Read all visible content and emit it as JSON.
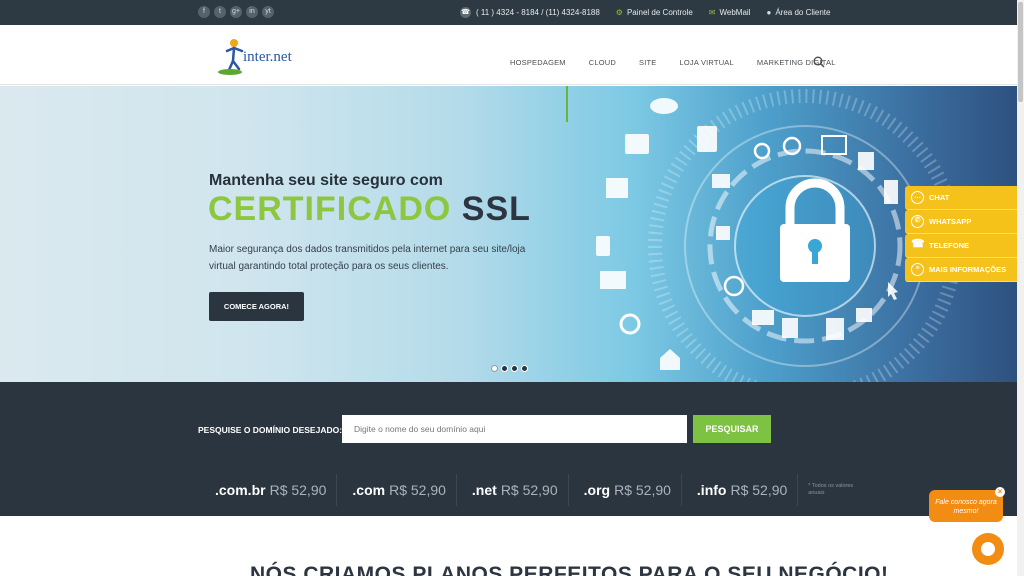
{
  "topbar": {
    "social_icons": [
      "f",
      "t",
      "g+",
      "in",
      "yt"
    ],
    "phone": "( 11 ) 4324 - 8184 / (11) 4324-8188",
    "links": [
      "Painel de Controle",
      "WebMail",
      "Área do Cliente"
    ]
  },
  "header": {
    "logo_text": "inter.net",
    "nav": [
      "HOSPEDAGEM",
      "CLOUD",
      "SITE",
      "LOJA VIRTUAL",
      "MARKETING DIGITAL"
    ]
  },
  "hero": {
    "subtitle": "Mantenha seu site seguro com",
    "title_green": "CERTIFICADO",
    "title_dark": "SSL",
    "description": "Maior segurança dos dados transmitidos pela internet para seu site/loja virtual garantindo total proteção para os seus clientes.",
    "cta": "COMECE AGORA!",
    "slides": 4,
    "active_slide": 1
  },
  "side_panel": [
    {
      "icon": "chat-icon",
      "label": "CHAT"
    },
    {
      "icon": "whatsapp-icon",
      "label": "WHATSAPP"
    },
    {
      "icon": "phone-icon",
      "label": "TELEFONE"
    },
    {
      "icon": "info-icon",
      "label": "MAIS INFORMAÇÕES"
    }
  ],
  "domain": {
    "label": "PESQUISE O DOMÍNIO DESEJADO:",
    "placeholder": "Digite o nome do seu domínio aqui",
    "button": "PESQUISAR",
    "prices": [
      {
        "ext": ".com.br",
        "price": "R$ 52,90"
      },
      {
        "ext": ".com",
        "price": "R$ 52,90"
      },
      {
        "ext": ".net",
        "price": "R$ 52,90"
      },
      {
        "ext": ".org",
        "price": "R$ 52,90"
      },
      {
        "ext": ".info",
        "price": "R$ 52,90"
      }
    ],
    "note": "* Todos os valores anuais"
  },
  "plans": {
    "title": "NÓS CRIAMOS PLANOS PERFEITOS PARA O SEU NEGÓCIO!"
  },
  "chat": {
    "bubble": "Fale conosco agora mesmo!",
    "close": "×"
  },
  "colors": {
    "dark": "#2b353f",
    "green": "#8dc63f",
    "yellow": "#f4c21b",
    "orange": "#f28c12"
  }
}
